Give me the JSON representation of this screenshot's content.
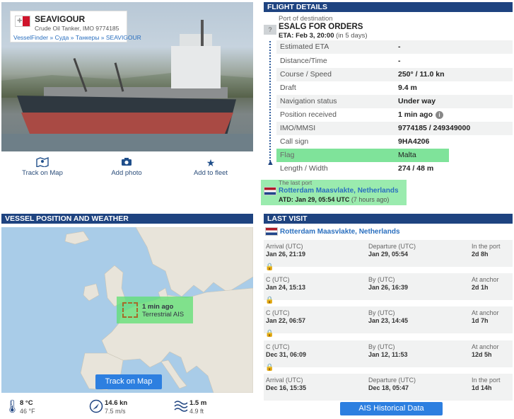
{
  "vessel": {
    "name": "SEAVIGOUR",
    "type_imo": "Crude Oil Tanker, IMO 9774185",
    "breadcrumb": "VesselFinder » Суда » Танкеры » SEAVIGOUR",
    "flag_cross": "✚"
  },
  "actions": [
    {
      "label": "Track on Map",
      "icon": "map-pin-icon"
    },
    {
      "label": "Add photo",
      "icon": "camera-icon"
    },
    {
      "label": "Add to fleet",
      "icon": "star-icon"
    }
  ],
  "flight_details": {
    "header": "FLIGHT DETAILS",
    "dest_label": "Port of destination",
    "dest_q": "?",
    "dest_name": "ESALG FOR ORDERS",
    "eta_prefix": "ETA: Feb 3, 20:00",
    "eta_suffix": "(in 5 days)",
    "rows": [
      {
        "k": "Estimated ETA",
        "v": "-"
      },
      {
        "k": "Distance/Time",
        "v": "-"
      },
      {
        "k": "Course / Speed",
        "v": "250° / 11.0 kn"
      },
      {
        "k": "Draft",
        "v": "9.4 m"
      },
      {
        "k": "Navigation status",
        "v": "Under way"
      },
      {
        "k": "Position received",
        "v": "1 min ago"
      },
      {
        "k": "IMO/MMSI",
        "v": "9774185 / 249349000"
      },
      {
        "k": "Call sign",
        "v": "9HA4206"
      },
      {
        "k": "Flag",
        "v": "Malta"
      },
      {
        "k": "Length / Width",
        "v": "274 / 48 m"
      }
    ],
    "info_glyph": "i",
    "last_port_label": "The last port",
    "last_port_name": "Rotterdam Maasvlakte, Netherlands",
    "atd_prefix": "ATD: Jan 29, 05:54 UTC",
    "atd_suffix": "(7 hours ago)"
  },
  "position": {
    "header": "VESSEL POSITION AND WEATHER",
    "ais_time": "1 min ago",
    "ais_source": "Terrestrial AIS",
    "track_button": "Track on Map"
  },
  "weather": {
    "temp_c": "8 °C",
    "temp_f": "46 °F",
    "wind_kn": "14.6 kn",
    "wind_ms": "7.5 m/s",
    "wave_m": "1.5 m",
    "wave_ft": "4.9 ft"
  },
  "last_visit": {
    "header": "LAST VISIT",
    "port": "Rotterdam Maasvlakte, Netherlands",
    "lock": "🔒",
    "visits": [
      {
        "c1": "Arrival (UTC)",
        "d1": "Jan 26, 21:19",
        "c2": "Departure (UTC)",
        "d2": "Jan 29, 05:54",
        "c3": "In the port",
        "d3": "2d 8h"
      },
      {
        "c1": "C (UTC)",
        "d1": "Jan 24, 15:13",
        "c2": "By (UTC)",
        "d2": "Jan 26, 16:39",
        "c3": "At anchor",
        "d3": "2d 1h"
      },
      {
        "c1": "C (UTC)",
        "d1": "Jan 22, 06:57",
        "c2": "By (UTC)",
        "d2": "Jan 23, 14:45",
        "c3": "At anchor",
        "d3": "1d 7h"
      },
      {
        "c1": "C (UTC)",
        "d1": "Dec 31, 06:09",
        "c2": "By (UTC)",
        "d2": "Jan 12, 11:53",
        "c3": "At anchor",
        "d3": "12d 5h"
      },
      {
        "c1": "Arrival (UTC)",
        "d1": "Dec 16, 15:35",
        "c2": "Departure (UTC)",
        "d2": "Dec 18, 05:47",
        "c3": "In the port",
        "d3": "1d 14h"
      }
    ],
    "ais_button": "AIS Historical Data"
  }
}
